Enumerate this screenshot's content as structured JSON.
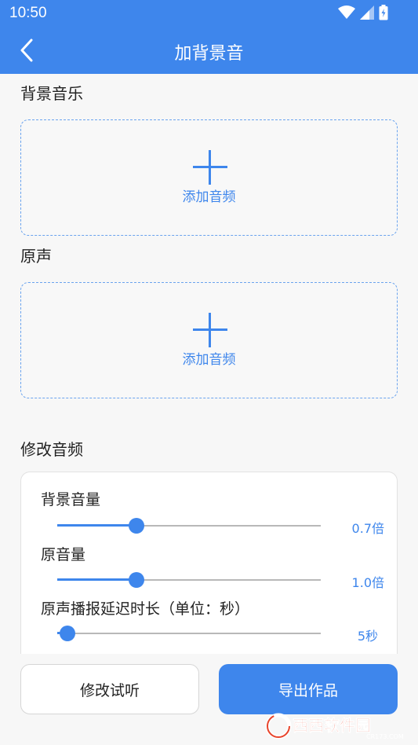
{
  "status_bar": {
    "time": "10:50"
  },
  "app_bar": {
    "title": "加背景音"
  },
  "sections": {
    "bgm_label": "背景音乐",
    "original_label": "原声",
    "modify_label": "修改音频"
  },
  "upload": {
    "bgm_text": "添加音频",
    "original_text": "添加音频"
  },
  "sliders": [
    {
      "label": "背景音量",
      "value_text": "0.7倍",
      "level": 0.3
    },
    {
      "label": "原音量",
      "value_text": "1.0倍",
      "level": 0.3
    },
    {
      "label": "原声播报延迟时长（单位：秒）",
      "value_text": "5秒",
      "level": 0.04
    }
  ],
  "buttons": {
    "preview_label": "修改试听",
    "export_label": "导出作品"
  },
  "watermark": {
    "brand": "西西软件园",
    "domain": "CR173.COM"
  },
  "colors": {
    "primary": "#3e86ec",
    "border": "#6aa3ee"
  }
}
